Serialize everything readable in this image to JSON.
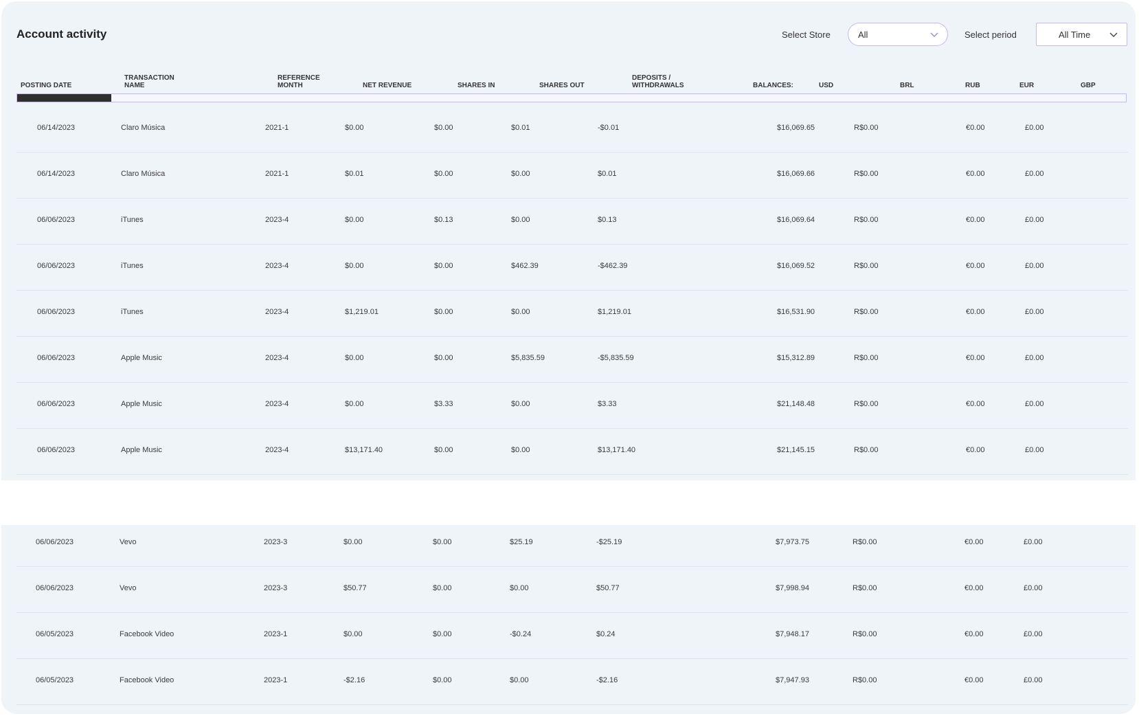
{
  "title": "Account activity",
  "controls": {
    "store_label": "Select Store",
    "store_value": "All",
    "period_label": "Select period",
    "period_value": "All Time"
  },
  "icons": {
    "dropdown": "chevron-down-icon"
  },
  "colors": {
    "panel_bg": "#eff4f9",
    "accent_border": "#c8b7ea",
    "scroll_thumb": "#2f2f2f"
  },
  "columns": [
    {
      "key": "posting_date",
      "l1": "",
      "l2": "POSTING DATE"
    },
    {
      "key": "transaction_name",
      "l1": "TRANSACTION",
      "l2": "NAME"
    },
    {
      "key": "reference_month",
      "l1": "REFERENCE",
      "l2": "MONTH"
    },
    {
      "key": "net_revenue",
      "l1": "",
      "l2": "NET REVENUE"
    },
    {
      "key": "shares_in",
      "l1": "",
      "l2": "SHARES IN"
    },
    {
      "key": "shares_out",
      "l1": "",
      "l2": "SHARES OUT"
    },
    {
      "key": "deposits_withdrawals",
      "l1": "DEPOSITS /",
      "l2": "WITHDRAWALS"
    },
    {
      "key": "balances",
      "l1": "",
      "l2": "BALANCES:"
    },
    {
      "key": "usd",
      "l1": "",
      "l2": "USD"
    },
    {
      "key": "brl",
      "l1": "",
      "l2": "BRL"
    },
    {
      "key": "rub",
      "l1": "",
      "l2": "RUB"
    },
    {
      "key": "eur",
      "l1": "",
      "l2": "EUR"
    },
    {
      "key": "gbp",
      "l1": "",
      "l2": "GBP"
    }
  ],
  "rows": [
    [
      "06/14/2023",
      "Claro Música",
      "2021-1",
      "$0.00",
      "$0.00",
      "$0.01",
      "-$0.01",
      "",
      "$16,069.65",
      "R$0.00",
      "",
      "€0.00",
      "£0.00"
    ],
    [
      "06/14/2023",
      "Claro Música",
      "2021-1",
      "$0.01",
      "$0.00",
      "$0.00",
      "$0.01",
      "",
      "$16,069.66",
      "R$0.00",
      "",
      "€0.00",
      "£0.00"
    ],
    [
      "06/06/2023",
      "iTunes",
      "2023-4",
      "$0.00",
      "$0.13",
      "$0.00",
      "$0.13",
      "",
      "$16,069.64",
      "R$0.00",
      "",
      "€0.00",
      "£0.00"
    ],
    [
      "06/06/2023",
      "iTunes",
      "2023-4",
      "$0.00",
      "$0.00",
      "$462.39",
      "-$462.39",
      "",
      "$16,069.52",
      "R$0.00",
      "",
      "€0.00",
      "£0.00"
    ],
    [
      "06/06/2023",
      "iTunes",
      "2023-4",
      "$1,219.01",
      "$0.00",
      "$0.00",
      "$1,219.01",
      "",
      "$16,531.90",
      "R$0.00",
      "",
      "€0.00",
      "£0.00"
    ],
    [
      "06/06/2023",
      "Apple Music",
      "2023-4",
      "$0.00",
      "$0.00",
      "$5,835.59",
      "-$5,835.59",
      "",
      "$15,312.89",
      "R$0.00",
      "",
      "€0.00",
      "£0.00"
    ],
    [
      "06/06/2023",
      "Apple Music",
      "2023-4",
      "$0.00",
      "$3.33",
      "$0.00",
      "$3.33",
      "",
      "$21,148.48",
      "R$0.00",
      "",
      "€0.00",
      "£0.00"
    ],
    [
      "06/06/2023",
      "Apple Music",
      "2023-4",
      "$13,171.40",
      "$0.00",
      "$0.00",
      "$13,171.40",
      "",
      "$21,145.15",
      "R$0.00",
      "",
      "€0.00",
      "£0.00"
    ],
    [
      "06/06/2023",
      "Vevo",
      "2023-3",
      "$0.00",
      "$0.00",
      "$25.19",
      "-$25.19",
      "",
      "$7,973.75",
      "R$0.00",
      "",
      "€0.00",
      "£0.00"
    ],
    [
      "06/06/2023",
      "Vevo",
      "2023-3",
      "$50.77",
      "$0.00",
      "$0.00",
      "$50.77",
      "",
      "$7,998.94",
      "R$0.00",
      "",
      "€0.00",
      "£0.00"
    ],
    [
      "06/05/2023",
      "Facebook Video",
      "2023-1",
      "$0.00",
      "$0.00",
      "-$0.24",
      "$0.24",
      "",
      "$7,948.17",
      "R$0.00",
      "",
      "€0.00",
      "£0.00"
    ],
    [
      "06/05/2023",
      "Facebook Video",
      "2023-1",
      "-$2.16",
      "$0.00",
      "$0.00",
      "-$2.16",
      "",
      "$7,947.93",
      "R$0.00",
      "",
      "€0.00",
      "£0.00"
    ]
  ]
}
